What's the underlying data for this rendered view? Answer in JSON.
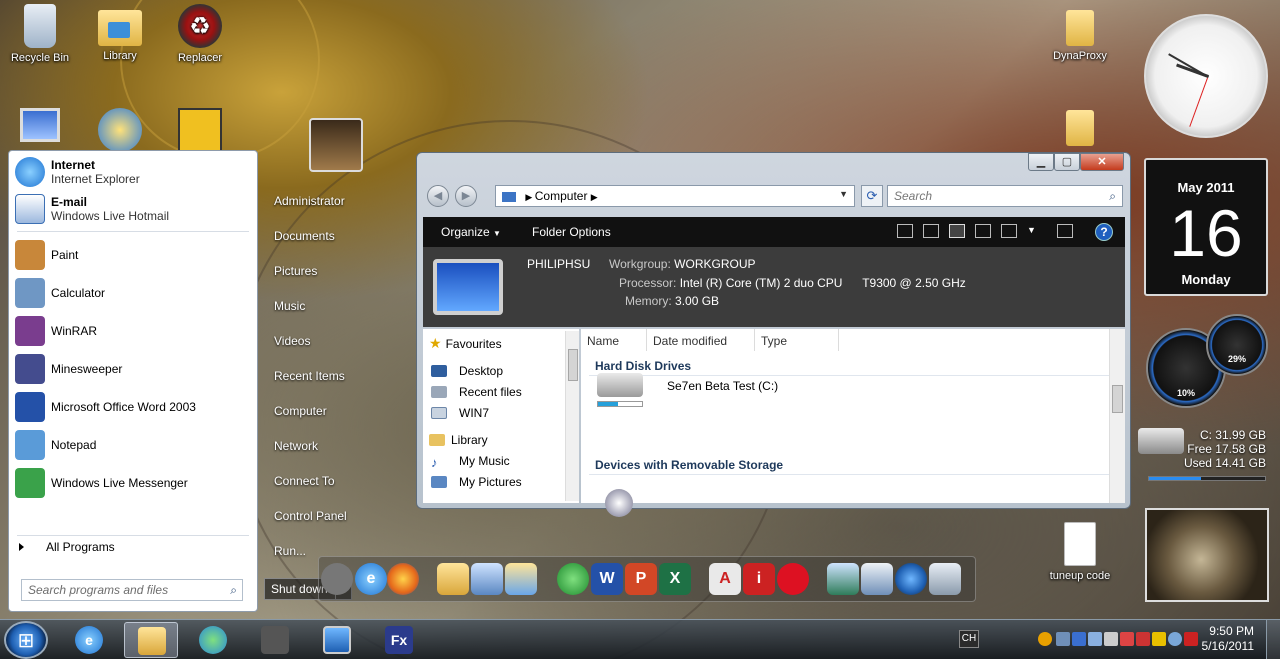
{
  "desktop": {
    "icons": [
      {
        "label": "Recycle Bin",
        "icon": "recycle-bin-icon"
      },
      {
        "label": "Library",
        "icon": "library-folder-icon"
      },
      {
        "label": "Replacer",
        "icon": "replacer-icon"
      },
      {
        "label": "DynaProxy",
        "icon": "folder-icon"
      },
      {
        "label": "tuneup code",
        "icon": "text-document-icon"
      }
    ]
  },
  "start_menu": {
    "pinned": [
      {
        "title": "Internet",
        "subtitle": "Internet Explorer",
        "icon": "internet-explorer-icon",
        "color": "#1e73d2"
      },
      {
        "title": "E-mail",
        "subtitle": "Windows Live Hotmail",
        "icon": "hotmail-icon",
        "color": "#3b6fb4"
      }
    ],
    "recent": [
      {
        "label": "Paint",
        "icon": "paint-icon",
        "color": "#c8873a"
      },
      {
        "label": "Calculator",
        "icon": "calculator-icon",
        "color": "#6f97c4"
      },
      {
        "label": "WinRAR",
        "icon": "winrar-icon",
        "color": "#7a3d8e"
      },
      {
        "label": "Minesweeper",
        "icon": "minesweeper-icon",
        "color": "#444c8e"
      },
      {
        "label": "Microsoft Office Word 2003",
        "icon": "word-icon",
        "color": "#2451a8"
      },
      {
        "label": "Notepad",
        "icon": "notepad-icon",
        "color": "#5a9bd8"
      },
      {
        "label": "Windows Live Messenger",
        "icon": "messenger-icon",
        "color": "#3aa24a"
      }
    ],
    "all_programs": "All Programs",
    "search_placeholder": "Search programs and files",
    "right_items": [
      "Administrator",
      "Documents",
      "Pictures",
      "Music",
      "Videos",
      "Recent Items",
      "Computer",
      "Network",
      "Connect To",
      "Control Panel",
      "Run..."
    ],
    "shutdown": "Shut down"
  },
  "explorer": {
    "address": "Computer",
    "search_placeholder": "Search",
    "commands": {
      "organize": "Organize",
      "folder_options": "Folder Options"
    },
    "details": {
      "computer_name": "PHILIPHSU",
      "workgroup_label": "Workgroup:",
      "workgroup": "WORKGROUP",
      "processor_label": "Processor:",
      "processor": "Intel (R) Core (TM) 2 duo CPU      T9300 @ 2.50 GHz",
      "memory_label": "Memory:",
      "memory": "3.00 GB"
    },
    "nav": {
      "favourites": "Favourites",
      "fav_items": [
        "Desktop",
        "Recent files",
        "WIN7"
      ],
      "library": "Library",
      "lib_items": [
        "My Music",
        "My Pictures"
      ]
    },
    "columns": [
      "Name",
      "Date modified",
      "Type"
    ],
    "groups": {
      "hdd": "Hard Disk Drives",
      "removable": "Devices with Removable Storage"
    },
    "drive": {
      "label": "Se7en Beta Test (C:)",
      "used_fraction": 0.45
    }
  },
  "gadgets": {
    "calendar": {
      "month": "May 2011",
      "day": "16",
      "weekday": "Monday"
    },
    "meters": {
      "left": "10%",
      "right": "29%"
    },
    "disk": {
      "drive": "C:  31.99 GB",
      "free": "Free  17.58 GB",
      "used": "Used  14.41 GB",
      "used_fraction": 0.45
    }
  },
  "taskbar": {
    "language": "CH",
    "time": "9:50 PM",
    "date": "5/16/2011"
  }
}
